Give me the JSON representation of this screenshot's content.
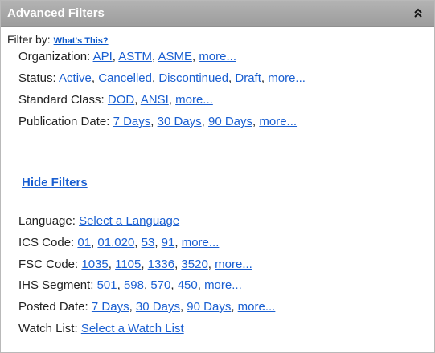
{
  "panel": {
    "title": "Advanced Filters"
  },
  "filter_by": {
    "label": "Filter by:",
    "help_link": "What's This?"
  },
  "hide_filters": "Hide Filters",
  "rows": [
    {
      "label": "Organization:",
      "links": [
        "API",
        "ASTM",
        "ASME",
        "more..."
      ]
    },
    {
      "label": "Status:",
      "links": [
        "Active",
        "Cancelled",
        "Discontinued",
        "Draft",
        "more..."
      ]
    },
    {
      "label": "Standard Class:",
      "links": [
        "DOD",
        "ANSI",
        "more..."
      ]
    },
    {
      "label": "Publication Date:",
      "links": [
        "7 Days",
        "30 Days",
        "90 Days",
        "more..."
      ]
    },
    {
      "label": "Language:",
      "links": [
        "Select a Language"
      ]
    },
    {
      "label": "ICS Code:",
      "links": [
        "01",
        "01.020",
        "53",
        "91",
        "more..."
      ]
    },
    {
      "label": "FSC Code:",
      "links": [
        "1035",
        "1105",
        "1336",
        "3520",
        "more..."
      ]
    },
    {
      "label": "IHS Segment:",
      "links": [
        "501",
        "598",
        "570",
        "450",
        "more..."
      ]
    },
    {
      "label": "Posted Date:",
      "links": [
        "7 Days",
        "30 Days",
        "90 Days",
        "more..."
      ]
    },
    {
      "label": "Watch List:",
      "links": [
        "Select a Watch List"
      ]
    }
  ],
  "colors": {
    "header_bg": "#a6a6a6",
    "link": "#1a5fd1",
    "text": "#222222"
  }
}
